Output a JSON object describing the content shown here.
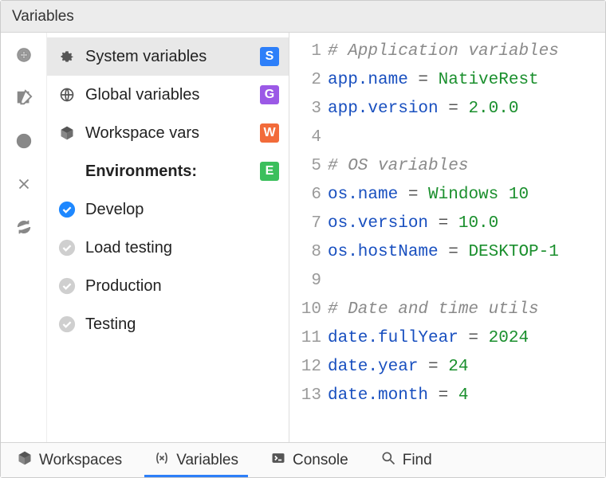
{
  "title": "Variables",
  "sidebar": {
    "scopes": [
      {
        "label": "System variables",
        "badge": "S",
        "active": true
      },
      {
        "label": "Global variables",
        "badge": "G",
        "active": false
      },
      {
        "label": "Workspace vars",
        "badge": "W",
        "active": false
      }
    ],
    "environments_heading": "Environments:",
    "environments_badge": "E",
    "environments": [
      {
        "label": "Develop",
        "selected": true
      },
      {
        "label": "Load testing",
        "selected": false
      },
      {
        "label": "Production",
        "selected": false
      },
      {
        "label": "Testing",
        "selected": false
      }
    ]
  },
  "editor": {
    "lines": [
      {
        "n": 1,
        "type": "comment",
        "text": "# Application variables"
      },
      {
        "n": 2,
        "type": "kv",
        "key": "app.name",
        "val": "NativeRest"
      },
      {
        "n": 3,
        "type": "kv",
        "key": "app.version",
        "val": "2.0.0"
      },
      {
        "n": 4,
        "type": "blank"
      },
      {
        "n": 5,
        "type": "comment",
        "text": "# OS variables"
      },
      {
        "n": 6,
        "type": "kv",
        "key": "os.name",
        "val": "Windows 10"
      },
      {
        "n": 7,
        "type": "kv",
        "key": "os.version",
        "val": "10.0"
      },
      {
        "n": 8,
        "type": "kv",
        "key": "os.hostName",
        "val": "DESKTOP-1"
      },
      {
        "n": 9,
        "type": "blank"
      },
      {
        "n": 10,
        "type": "comment",
        "text": "# Date and time utils"
      },
      {
        "n": 11,
        "type": "kv",
        "key": "date.fullYear",
        "val": "2024"
      },
      {
        "n": 12,
        "type": "kv",
        "key": "date.year",
        "val": "24"
      },
      {
        "n": 13,
        "type": "kv",
        "key": "date.month",
        "val": "4"
      }
    ]
  },
  "footer": {
    "tabs": [
      {
        "label": "Workspaces",
        "icon": "cube",
        "active": false
      },
      {
        "label": "Variables",
        "icon": "var",
        "active": true
      },
      {
        "label": "Console",
        "icon": "console",
        "active": false
      },
      {
        "label": "Find",
        "icon": "search",
        "active": false
      }
    ]
  }
}
